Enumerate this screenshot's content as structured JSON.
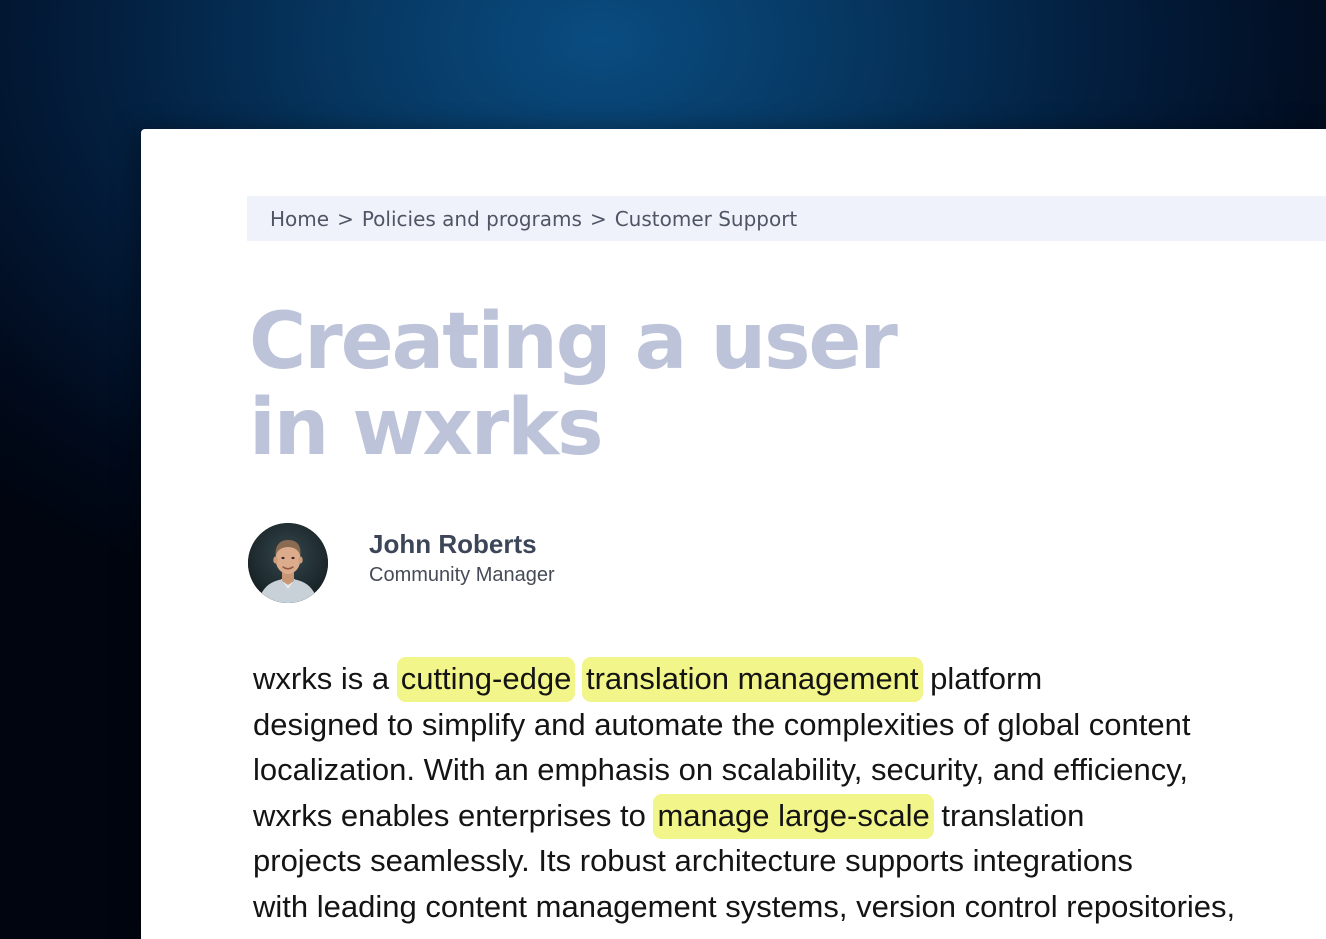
{
  "breadcrumb": {
    "items": [
      "Home",
      "Policies and programs",
      "Customer Support"
    ],
    "separator": ">"
  },
  "article": {
    "title_lines": [
      "Creating a user",
      "in wxrks"
    ],
    "author": {
      "name": "John Roberts",
      "role": "Community Manager"
    },
    "body": {
      "line1": {
        "before": "wxrks is a",
        "hl1": "cutting-edge",
        "hl2": "translation management",
        "after": "platform"
      },
      "line2": "designed to simplify and automate the complexities of global content",
      "line3": "localization. With an emphasis on scalability, security, and efficiency,",
      "line4": {
        "before": "wxrks enables enterprises to",
        "hl": "manage large-scale",
        "after": "translation"
      },
      "line5": "projects seamlessly. Its robust architecture supports integrations",
      "line6": "with leading content management systems, version control repositories,"
    }
  },
  "colors": {
    "background_dark": "#010a1c",
    "background_glow": "#0a4c80",
    "title": "#bdc4d9",
    "highlight": "#f2f589",
    "breadcrumb_bg": "#eff2fa",
    "text": "#141414"
  },
  "icons": {
    "avatar": "author-avatar-photo"
  }
}
